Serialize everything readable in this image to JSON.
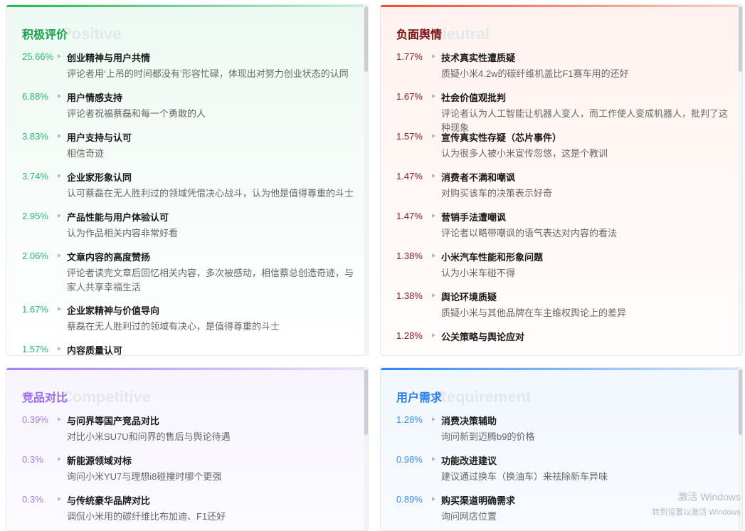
{
  "cards": [
    {
      "id": "positive",
      "title": "积极评价",
      "watermark": "Positive",
      "color": "#1aaa55",
      "pct_color": "#2bb673",
      "title_color": "#17a34a",
      "grad": "linear-gradient(90deg,#1db954,#c8eed8)",
      "bg": "linear-gradient(180deg,#eef9f3,#ffffff)",
      "items": [
        {
          "pct": "25.66%",
          "title": "创业精神与用户共情",
          "desc": "评论者用‘上吊的时间都没有’形容忙碌，体现出对努力创业状态的认同"
        },
        {
          "pct": "6.88%",
          "title": "用户情感支持",
          "desc": "评论者祝福蔡磊和每一个勇敢的人"
        },
        {
          "pct": "3.83%",
          "title": "用户支持与认可",
          "desc": "相信奇迹"
        },
        {
          "pct": "3.74%",
          "title": "企业家形象认同",
          "desc": "认可蔡磊在无人胜利过的领域凭借决心战斗，认为他是值得尊重的斗士"
        },
        {
          "pct": "2.95%",
          "title": "产品性能与用户体验认可",
          "desc": "认为作品相关内容非常好看"
        },
        {
          "pct": "2.06%",
          "title": "文章内容的高度赞扬",
          "desc": "评论者读完文章后回忆相关内容，多次被感动，相信蔡总创造奇迹，与家人共享幸福生活"
        },
        {
          "pct": "1.67%",
          "title": "企业家精神与价值导向",
          "desc": "蔡磊在无人胜利过的领域有决心，是值得尊重的斗士"
        },
        {
          "pct": "1.57%",
          "title": "内容质量认可",
          "desc": ""
        }
      ]
    },
    {
      "id": "negative",
      "title": "负面舆情",
      "watermark": "Neutral",
      "color": "#f04a2a",
      "pct_color": "#8b1a1a",
      "title_color": "#7a1010",
      "grad": "linear-gradient(90deg,#f5472a,#fbd0c6)",
      "bg": "linear-gradient(180deg,#fff2ef,#fffdfc)",
      "items": [
        {
          "pct": "1.77%",
          "title": "技术真实性遭质疑",
          "desc": "质疑小米4.2w的碳纤维机盖比F1赛车用的还好"
        },
        {
          "pct": "1.67%",
          "title": "社会价值观批判",
          "desc": "评论者认为人工智能让机器人变人，而工作使人变成机器人，批判了这种现象"
        },
        {
          "pct": "1.57%",
          "title": "宣传真实性存疑（芯片事件）",
          "desc": "认为很多人被小米宣传忽悠，这是个教训"
        },
        {
          "pct": "1.47%",
          "title": "消费者不满和嘲讽",
          "desc": "对购买该车的决策表示好奇"
        },
        {
          "pct": "1.47%",
          "title": "营销手法遭嘲讽",
          "desc": "评论者以略带嘲讽的语气表达对内容的看法"
        },
        {
          "pct": "1.38%",
          "title": "小米汽车性能和形象问题",
          "desc": "认为小米车碰不得"
        },
        {
          "pct": "1.38%",
          "title": "舆论环境质疑",
          "desc": "质疑小米与其他品牌在车主维权舆论上的差异"
        },
        {
          "pct": "1.28%",
          "title": "公关策略与舆论应对",
          "desc": ""
        }
      ]
    },
    {
      "id": "competitive",
      "title": "竞品对比",
      "watermark": "Competitive",
      "color": "#a67cf0",
      "pct_color": "#a27cf2",
      "title_color": "#9b6cf0",
      "grad": "linear-gradient(90deg,#a57ef5,#ece2fd)",
      "bg": "linear-gradient(180deg,#f7f4fe,#fcfbff)",
      "items": [
        {
          "pct": "0.39%",
          "title": "与问界等国产竞品对比",
          "desc": "对比小米SU7U和问界的售后与舆论待遇"
        },
        {
          "pct": "0.3%",
          "title": "新能源领域对标",
          "desc": "询问小米YU7与理想i8碰撞时哪个更强"
        },
        {
          "pct": "0.3%",
          "title": "与传统豪华品牌对比",
          "desc": "调侃小米用的碳纤维比布加迪、F1还好"
        }
      ]
    },
    {
      "id": "requirement",
      "title": "用户需求",
      "watermark": "Requirement",
      "color": "#2f86f6",
      "pct_color": "#3a8ef5",
      "title_color": "#2a7ff0",
      "grad": "linear-gradient(90deg,#2d85f5,#d6e8fd)",
      "bg": "linear-gradient(180deg,#f1f7fe,#f8fbff)",
      "items": [
        {
          "pct": "1.28%",
          "title": "消费决策辅助",
          "desc": "询问新到迈腾b9的价格"
        },
        {
          "pct": "0.98%",
          "title": "功能改进建议",
          "desc": "建议通过换车（换油车）来祛除新车异味"
        },
        {
          "pct": "0.89%",
          "title": "购买渠道明确需求",
          "desc": "询问网店位置"
        }
      ]
    }
  ],
  "windows_notice": {
    "line1": "激活 Windows",
    "line2": "转到设置以激活 Windows"
  }
}
